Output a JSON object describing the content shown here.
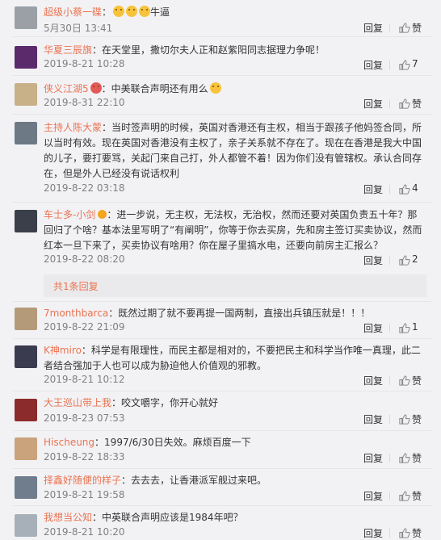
{
  "reply_label": "回复",
  "like_label": "赞",
  "colors": {
    "username": "#eb7350",
    "date": "#808080",
    "text": "#333333"
  },
  "comments": [
    {
      "user": "超级小蔡一碟",
      "text": "牛逼",
      "date": "5月30日 13:41",
      "likes": "",
      "emoji": [
        "laugh-emoji",
        "laugh-emoji",
        "laugh-emoji"
      ]
    },
    {
      "user": "华夏三辰旗",
      "text": "在天堂里，撒切尔夫人正和赵紫阳同志据理力争呢！",
      "date": "2019-8-21 10:28",
      "likes": "7"
    },
    {
      "user": "侠义江湖5",
      "text": "中美联合声明还有用么",
      "date": "2019-8-31 22:10",
      "likes": ""
    },
    {
      "user": "主持人陈大蒙",
      "text": "当时签声明的时候，英国对香港还有主权，相当于跟孩子他妈签合同，所以当时有效。现在英国对香港没有主权了，亲子关系就不存在了。现在在香港是我大中国的儿子，要打要骂，关起门来自己打，外人都管不着！因为你们没有管辖权。承认合同存在，但是外人已经没有说话权利",
      "date": "2019-8-22 03:18",
      "likes": "4"
    },
    {
      "user": "车士多-小剑",
      "text": "进一步说，无主权，无法权，无治权，然而还要对英国负责五十年？那回归了个啥？基本法里写明了“有阐明”，你等于你去买房，先和房主签订买卖协议，然而红本一旦下来了，买卖协议有啥用？你在屋子里搞水电，还要向前房主汇报么？",
      "date": "2019-8-22 08:20",
      "likes": "2",
      "more_replies": "共1条回复"
    },
    {
      "user": "7monthbarca",
      "text": "既然过期了就不要再提一国两制，直接出兵镇压就是！！！",
      "date": "2019-8-22 21:09",
      "likes": "1"
    },
    {
      "user": "K神miro",
      "text": "科学是有限理性，而民主都是相对的，不要把民主和科学当作唯一真理，此二者结合强加于人也可以成为胁迫他人价值观的邪教。",
      "date": "2019-8-21 10:12",
      "likes": ""
    },
    {
      "user": "大王巡山带上我",
      "text": "咬文嚼字，你开心就好",
      "date": "2019-8-23 07:53",
      "likes": ""
    },
    {
      "user": "Hischeung",
      "text": "1997/6/30日失效。麻烦百度一下",
      "date": "2019-8-22 18:33",
      "likes": ""
    },
    {
      "user": "择鑫好随便的样子",
      "text": "去去去，让香港派军舰过来吧。",
      "date": "2019-8-21 19:58",
      "likes": ""
    },
    {
      "user": "我想当公知",
      "text": "中英联合声明应该是1984年吧？",
      "date": "2019-8-21 10:20",
      "likes": ""
    }
  ]
}
